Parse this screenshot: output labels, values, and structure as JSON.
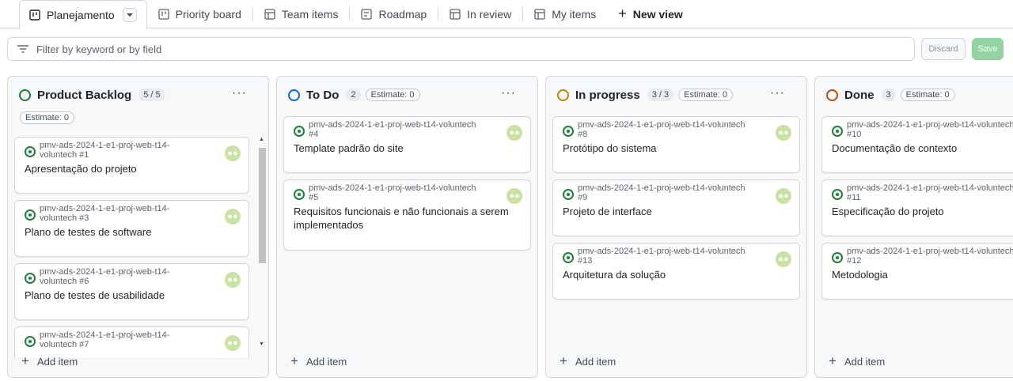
{
  "tabs": [
    {
      "label": "Planejamento",
      "icon": "board-icon"
    },
    {
      "label": "Priority board",
      "icon": "board-icon"
    },
    {
      "label": "Team items",
      "icon": "table-icon"
    },
    {
      "label": "Roadmap",
      "icon": "roadmap-icon"
    },
    {
      "label": "In review",
      "icon": "table-icon"
    },
    {
      "label": "My items",
      "icon": "table-icon"
    },
    {
      "label": "New view",
      "icon": "plus-icon"
    }
  ],
  "filter": {
    "placeholder": "Filter by keyword or by field"
  },
  "buttons": {
    "discard": "Discard",
    "save": "Save"
  },
  "add_item": "Add item",
  "colors": {
    "backlog": "#1a7f37",
    "todo": "#0969da",
    "inprogress": "#bf8700",
    "done": "#bc4c00"
  },
  "columns": [
    {
      "title": "Product Backlog",
      "count": "5 / 5",
      "estimate": "Estimate: 0",
      "cards": [
        {
          "repo": "pmv-ads-2024-1-e1-proj-web-t14-voluntech #1",
          "title": "Apresentação do projeto"
        },
        {
          "repo": "pmv-ads-2024-1-e1-proj-web-t14-voluntech #3",
          "title": "Plano de testes de software"
        },
        {
          "repo": "pmv-ads-2024-1-e1-proj-web-t14-voluntech #6",
          "title": "Plano de testes de usabilidade"
        },
        {
          "repo": "pmv-ads-2024-1-e1-proj-web-t14-voluntech #7",
          "title": ""
        }
      ]
    },
    {
      "title": "To Do",
      "count": "2",
      "estimate": "Estimate: 0",
      "cards": [
        {
          "repo": "pmv-ads-2024-1-e1-proj-web-t14-voluntech",
          "num": "#4",
          "title": "Template padrão do site"
        },
        {
          "repo": "pmv-ads-2024-1-e1-proj-web-t14-voluntech",
          "num": "#5",
          "title": "Requisitos funcionais e não funcionais a serem implementados"
        }
      ]
    },
    {
      "title": "In progress",
      "count": "3 / 3",
      "estimate": "Estimate: 0",
      "cards": [
        {
          "repo": "pmv-ads-2024-1-e1-proj-web-t14-voluntech",
          "num": "#8",
          "title": "Protótipo do sistema"
        },
        {
          "repo": "pmv-ads-2024-1-e1-proj-web-t14-voluntech",
          "num": "#9",
          "title": "Projeto de interface"
        },
        {
          "repo": "pmv-ads-2024-1-e1-proj-web-t14-voluntech",
          "num": "#13",
          "title": "Arquitetura da solução"
        }
      ]
    },
    {
      "title": "Done",
      "count": "3",
      "estimate": "Estimate: 0",
      "cards": [
        {
          "repo": "pmv-ads-2024-1-e1-proj-web-t14-voluntech",
          "num": "#10",
          "title": "Documentação de contexto"
        },
        {
          "repo": "pmv-ads-2024-1-e1-proj-web-t14-voluntech",
          "num": "#11",
          "title": "Especificação do projeto"
        },
        {
          "repo": "pmv-ads-2024-1-e1-proj-web-t14-voluntech",
          "num": "#12",
          "title": "Metodologia"
        }
      ]
    }
  ]
}
